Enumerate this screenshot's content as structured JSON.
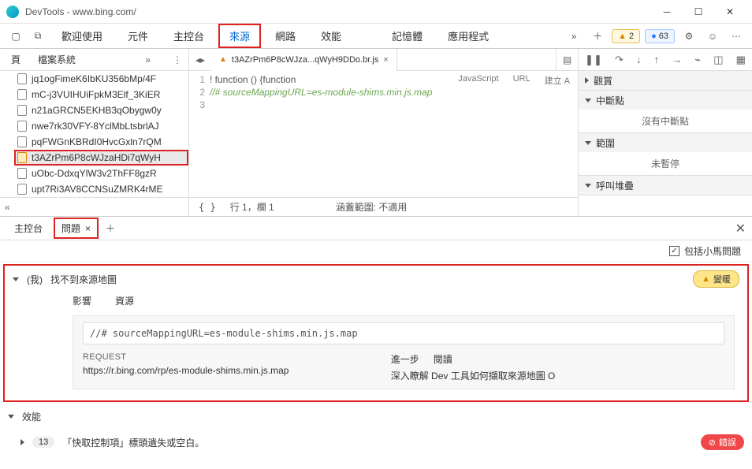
{
  "titlebar": {
    "title": "DevTools - www.bing.com/"
  },
  "maintabs": {
    "welcome": "歡迎使用",
    "elements": "元件",
    "console": "主控台",
    "sources": "來源",
    "network": "網路",
    "performance": "效能",
    "memory": "記憶體",
    "application": "應用程式",
    "warn_count": "2",
    "info_count": "63"
  },
  "sidebar": {
    "tab_page": "頁",
    "tab_filesystem": "檔案系統",
    "files": [
      "jq1ogFimeK6IbKU356bMp/4F",
      "mC-j3VUIHUiFpkM3Elf_3KiER",
      "n21aGRCN5EKHB3qObygw0y",
      "nwe7rk30VFY-8YclMbLtsbrlAJ",
      "pqFWGnKBRdI0HvcGxln7rQM",
      "t3AZrPm6P8cWJzaHDi7qWyH",
      "uObc-DdxqYlW3v2ThFF8gzR",
      "upt7Ri3AV8CCNSuZMRK4rME"
    ]
  },
  "editor": {
    "tabname": "t3AZrPm6P8cWJza...qWyH9DDo.br.js",
    "line1": "! function () {function",
    "line2": "//# sourceMappingURL=es-module-shims.min.js.map",
    "meta_js": "JavaScript",
    "meta_url": "URL",
    "meta_build": "建立 A",
    "ln1": "1",
    "ln2": "2",
    "ln3": "3",
    "footer_pos": "行 1，欄 1",
    "footer_coverage": "涵蓋範圍: 不適用",
    "braces": "{ }"
  },
  "debugger": {
    "watch": "觀賞",
    "breakpoints": "中斷點",
    "no_breakpoints": "沒有中斷點",
    "scope": "範圍",
    "not_paused": "未暫停",
    "callstack": "呼叫堆疊"
  },
  "drawer": {
    "console": "主控台",
    "issues": "問題",
    "opt_include": "包括小馬問題"
  },
  "issue": {
    "count": "(我)",
    "title": "找不到來源地圖",
    "warm": "變暖",
    "sub_affect": "影響",
    "sub_res": "資源",
    "codeline": "//# sourceMappingURL=es-module-shims.min.js.map",
    "req_label": "REQUEST",
    "req_url": "https://r.bing.com/rp/es-module-shims.min.js.map",
    "further": "進一步",
    "read": "閱讀",
    "learn": "深入瞭解 Dev 工具如何擷取來源地圖 O"
  },
  "perf": {
    "title": "效能",
    "item_count": "13",
    "item_text": "「快取控制項」標頭遺失或空白。",
    "error": "錯誤"
  }
}
